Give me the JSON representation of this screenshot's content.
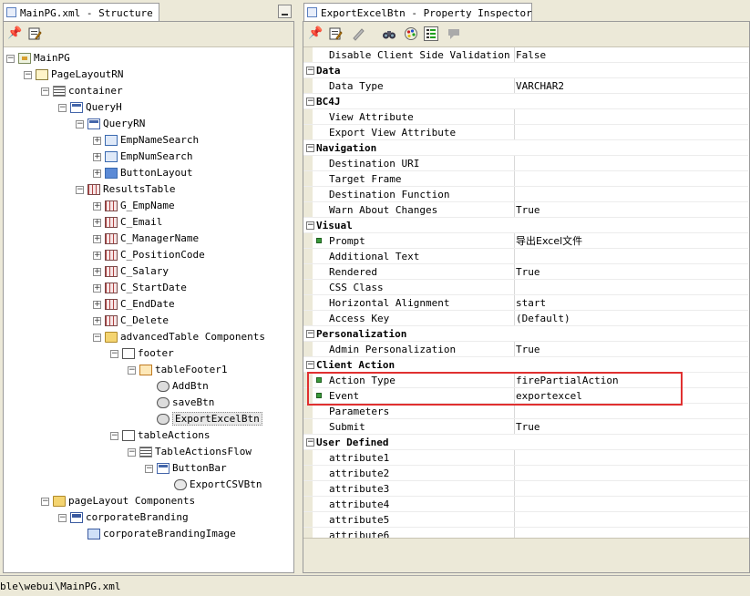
{
  "structure": {
    "tab_title": "MainPG.xml - Structure",
    "tree": [
      {
        "label": "MainPG",
        "icon": "page-icon",
        "level": 0,
        "exp": "-"
      },
      {
        "label": "PageLayoutRN",
        "icon": "page-layout-icon",
        "level": 1,
        "exp": "-"
      },
      {
        "label": "container",
        "icon": "stack-layout-icon",
        "level": 2,
        "exp": "-"
      },
      {
        "label": "QueryH",
        "icon": "header-region-icon",
        "level": 3,
        "exp": "-"
      },
      {
        "label": "QueryRN",
        "icon": "query-region-icon",
        "level": 4,
        "exp": "-"
      },
      {
        "label": "EmpNameSearch",
        "icon": "message-text-input-icon",
        "level": 5,
        "exp": "+"
      },
      {
        "label": "EmpNumSearch",
        "icon": "message-text-input-icon",
        "level": 5,
        "exp": "+"
      },
      {
        "label": "ButtonLayout",
        "icon": "button-layout-icon",
        "level": 5,
        "exp": "+"
      },
      {
        "label": "ResultsTable",
        "icon": "advanced-table-icon",
        "level": 4,
        "exp": "-"
      },
      {
        "label": "G_EmpName",
        "icon": "column-icon",
        "level": 5,
        "exp": "+"
      },
      {
        "label": "C_Email",
        "icon": "column-icon",
        "level": 5,
        "exp": "+"
      },
      {
        "label": "C_ManagerName",
        "icon": "column-icon",
        "level": 5,
        "exp": "+"
      },
      {
        "label": "C_PositionCode",
        "icon": "column-icon",
        "level": 5,
        "exp": "+"
      },
      {
        "label": "C_Salary",
        "icon": "column-icon",
        "level": 5,
        "exp": "+"
      },
      {
        "label": "C_StartDate",
        "icon": "column-icon",
        "level": 5,
        "exp": "+"
      },
      {
        "label": "C_EndDate",
        "icon": "column-icon",
        "level": 5,
        "exp": "+"
      },
      {
        "label": "C_Delete",
        "icon": "column-icon",
        "level": 5,
        "exp": "+"
      },
      {
        "label": "advancedTable Components",
        "icon": "folder-icon",
        "level": 5,
        "exp": "-"
      },
      {
        "label": "footer",
        "icon": "footer-icon",
        "level": 6,
        "exp": "-"
      },
      {
        "label": "tableFooter1",
        "icon": "table-footer-icon",
        "level": 7,
        "exp": "-"
      },
      {
        "label": "AddBtn",
        "icon": "button-icon",
        "level": 8,
        "exp": ""
      },
      {
        "label": "saveBtn",
        "icon": "button-icon",
        "level": 8,
        "exp": ""
      },
      {
        "label": "ExportExcelBtn",
        "icon": "button-icon",
        "level": 8,
        "exp": "",
        "selected": true
      },
      {
        "label": "tableActions",
        "icon": "table-actions-icon",
        "level": 6,
        "exp": "-"
      },
      {
        "label": "TableActionsFlow",
        "icon": "flow-layout-icon",
        "level": 7,
        "exp": "-"
      },
      {
        "label": "ButtonBar",
        "icon": "button-bar-icon",
        "level": 8,
        "exp": "-"
      },
      {
        "label": "ExportCSVBtn",
        "icon": "export-button-icon",
        "level": 9,
        "exp": ""
      },
      {
        "label": "pageLayout Components",
        "icon": "folder-icon",
        "level": 2,
        "exp": "-"
      },
      {
        "label": "corporateBranding",
        "icon": "branding-icon",
        "level": 3,
        "exp": "-"
      },
      {
        "label": "corporateBrandingImage",
        "icon": "image-icon",
        "level": 4,
        "exp": ""
      }
    ]
  },
  "inspector": {
    "tab_title": "ExportExcelBtn - Property Inspector",
    "toolbar_icons": [
      "pin-icon",
      "edit-icon",
      "pencil-icon",
      "binoculars-icon",
      "palette-icon",
      "categories-icon",
      "comment-icon"
    ],
    "rows": [
      {
        "kind": "prop",
        "name": "Disable Client Side Validation",
        "value": "False"
      },
      {
        "kind": "cat",
        "name": "Data"
      },
      {
        "kind": "prop",
        "name": "Data Type",
        "value": "VARCHAR2"
      },
      {
        "kind": "cat",
        "name": "BC4J"
      },
      {
        "kind": "prop",
        "name": "View Attribute",
        "value": ""
      },
      {
        "kind": "prop",
        "name": "Export View Attribute",
        "value": ""
      },
      {
        "kind": "cat",
        "name": "Navigation"
      },
      {
        "kind": "prop",
        "name": "Destination URI",
        "value": ""
      },
      {
        "kind": "prop",
        "name": "Target Frame",
        "value": ""
      },
      {
        "kind": "prop",
        "name": "Destination Function",
        "value": ""
      },
      {
        "kind": "prop",
        "name": "Warn About Changes",
        "value": "True"
      },
      {
        "kind": "cat",
        "name": "Visual"
      },
      {
        "kind": "prop",
        "name": "Prompt",
        "value": "导出Excel文件",
        "dot": true
      },
      {
        "kind": "prop",
        "name": "Additional Text",
        "value": ""
      },
      {
        "kind": "prop",
        "name": "Rendered",
        "value": "True"
      },
      {
        "kind": "prop",
        "name": "CSS Class",
        "value": ""
      },
      {
        "kind": "prop",
        "name": "Horizontal Alignment",
        "value": "start"
      },
      {
        "kind": "prop",
        "name": "Access Key",
        "value": "(Default)"
      },
      {
        "kind": "cat",
        "name": "Personalization"
      },
      {
        "kind": "prop",
        "name": "Admin Personalization",
        "value": "True"
      },
      {
        "kind": "cat",
        "name": "Client Action"
      },
      {
        "kind": "prop",
        "name": "Action Type",
        "value": "firePartialAction",
        "dot": true
      },
      {
        "kind": "prop",
        "name": "Event",
        "value": "exportexcel",
        "dot": true
      },
      {
        "kind": "prop",
        "name": "Parameters",
        "value": ""
      },
      {
        "kind": "prop",
        "name": "Submit",
        "value": "True"
      },
      {
        "kind": "cat",
        "name": "User Defined"
      },
      {
        "kind": "prop",
        "name": "attribute1",
        "value": ""
      },
      {
        "kind": "prop",
        "name": "attribute2",
        "value": ""
      },
      {
        "kind": "prop",
        "name": "attribute3",
        "value": ""
      },
      {
        "kind": "prop",
        "name": "attribute4",
        "value": ""
      },
      {
        "kind": "prop",
        "name": "attribute5",
        "value": ""
      },
      {
        "kind": "prop",
        "name": "attribute6",
        "value": ""
      }
    ]
  },
  "status_bar": {
    "path": "ble\\webui\\MainPG.xml"
  },
  "colors": {
    "highlight_box": "#e03030",
    "chrome": "#ece9d8"
  }
}
